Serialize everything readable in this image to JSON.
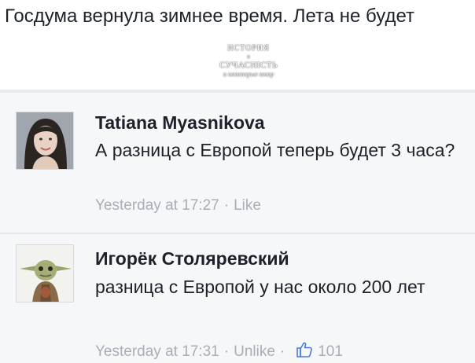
{
  "post": {
    "text": "Госдума вернула зимнее время. Лета не будет"
  },
  "watermark": {
    "line1": "ИСТОРИЯ",
    "line2": "и",
    "line3": "СУЧАСНІСТЬ",
    "line4": "и некоторые юмор"
  },
  "comments": [
    {
      "author": "Tatiana Myasnikova",
      "text": "А разница с Европой теперь будет 3 часа?",
      "time": "Yesterday at 17:27",
      "separator": "·",
      "action": "Like"
    },
    {
      "author": "Игорёк Столяревский",
      "text": "разница с Европой у нас около 200 лет",
      "time": "Yesterday at 17:31",
      "separator": "·",
      "action": "Unlike",
      "separator2": "·",
      "likes": "101"
    }
  ],
  "icons": {
    "like": "thumbs-up-icon"
  },
  "colors": {
    "text": "#1d2129",
    "meta": "#a8adb7",
    "comment_bg": "#f6f7f9"
  }
}
